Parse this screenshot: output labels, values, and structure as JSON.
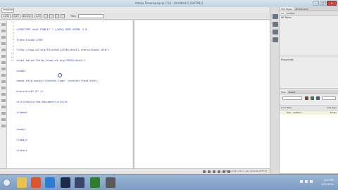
{
  "window": {
    "title": "Adobe Dreamweaver CS6 - [Untitled-1 (XHTML)]",
    "controls": [
      "–",
      "□",
      "✕"
    ]
  },
  "document_tab": "Untitled-1",
  "toolbar": {
    "code_label": "Code",
    "split_label": "Split",
    "design_label": "Design",
    "live_label": "Live",
    "title_label": "Title:"
  },
  "editor": {
    "line_numbers": [
      "1",
      "2",
      "3",
      "4",
      "5",
      "6",
      "7",
      "8",
      "9",
      "10",
      "11",
      "12"
    ],
    "lines": [
      "<!DOCTYPE html PUBLIC \"-//W3C//DTD XHTML 1.0",
      "Transitional//EN\"",
      "\"http://www.w3.org/TR/xhtml1/DTD/xhtml1-transitional.dtd\">",
      "<html xmlns=\"http://www.w3.org/1999/xhtml\">",
      "<head>",
      "<meta http-equiv=\"Content-Type\" content=\"text/html;",
      "charset=utf-8\" />",
      "<title>Untitled Document</title>",
      "</head>",
      "",
      "<body>",
      "</body>",
      "</html>"
    ]
  },
  "status": {
    "tag": "",
    "info": "832 x 314 v 1K / 1 sec Unicode (UTF-8)"
  },
  "panels": {
    "insert_tabs": [
      "CSS Styles",
      "AP Elements"
    ],
    "insert_sub": [
      "All",
      "Current"
    ],
    "all_rules": "All Rules",
    "properties": "Properties",
    "files_tabs": [
      "Files",
      "Assets"
    ],
    "files_site": "Local Files",
    "files_size": "Size Type",
    "files_row": "Site - Untitled ...",
    "files_row_type": "Folder"
  },
  "taskbar": {
    "time": "4:04 PM",
    "date": "3/31/2014"
  }
}
